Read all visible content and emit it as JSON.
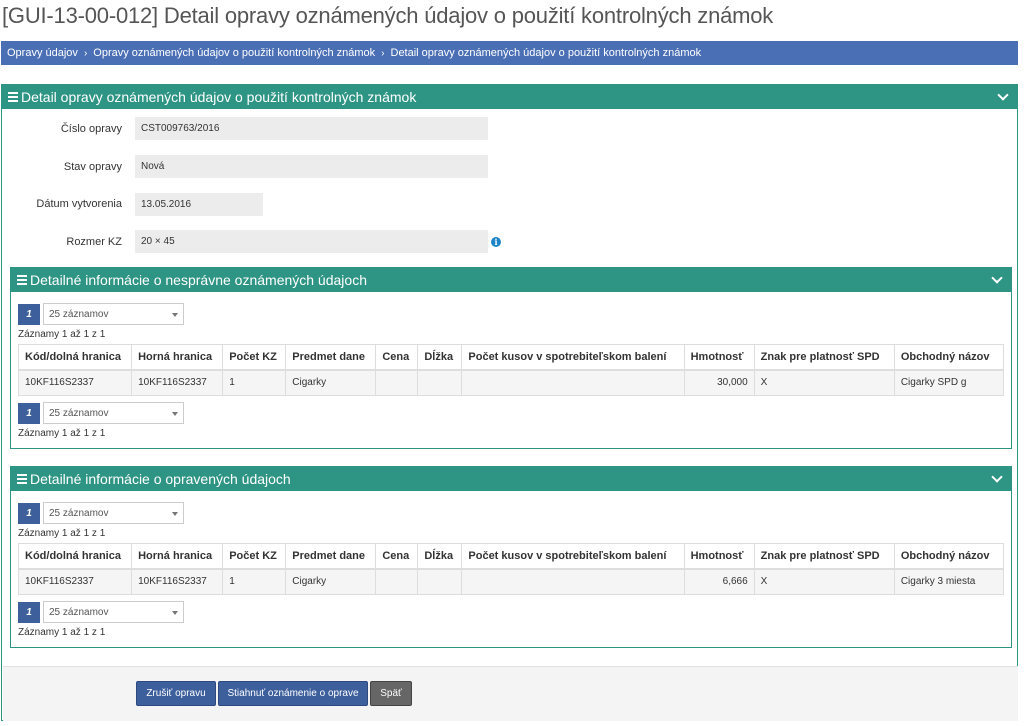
{
  "page_title": "[GUI-13-00-012] Detail opravy oznámených údajov o použití kontrolných známok",
  "breadcrumb": {
    "items": [
      "Opravy údajov",
      "Opravy oznámených údajov o použití kontrolných známok",
      "Detail opravy oznámených údajov o použití kontrolných známok"
    ],
    "separator": "›"
  },
  "main_panel": {
    "title": "Detail opravy oznámených údajov o použití kontrolných známok"
  },
  "form": {
    "cislo_opravy": {
      "label": "Číslo opravy",
      "value": "CST009763/2016"
    },
    "stav_opravy": {
      "label": "Stav opravy",
      "value": "Nová"
    },
    "datum_vytvorenia": {
      "label": "Dátum vytvorenia",
      "value": "13.05.2016"
    },
    "rozmer_kz": {
      "label": "Rozmer KZ",
      "value": "20 × 45"
    },
    "info_icon": "info-icon"
  },
  "pager": {
    "page": "1",
    "page_size": "25 záznamov",
    "records_info": "Záznamy 1 až 1 z 1"
  },
  "columns": [
    "Kód/dolná hranica",
    "Horná hranica",
    "Počet KZ",
    "Predmet dane",
    "Cena",
    "Dĺžka",
    "Počet kusov v spotrebiteľskom balení",
    "Hmotnosť",
    "Znak pre platnosť SPD",
    "Obchodný názov"
  ],
  "incorrect_panel": {
    "title": "Detailné informácie o nesprávne oznámených údajoch",
    "rows": [
      [
        "10KF116S2337",
        "10KF116S2337",
        "1",
        "Cigarky",
        "",
        "",
        "",
        "30,000",
        "X",
        "Cigarky SPD g"
      ]
    ]
  },
  "corrected_panel": {
    "title": "Detailné informácie o opravených údajoch",
    "rows": [
      [
        "10KF116S2337",
        "10KF116S2337",
        "1",
        "Cigarky",
        "",
        "",
        "",
        "6,666",
        "X",
        "Cigarky 3 miesta"
      ]
    ]
  },
  "buttons": {
    "cancel": "Zrušiť opravu",
    "download": "Stiahnuť oznámenie o oprave",
    "back": "Späť"
  },
  "colors": {
    "accent_teal": "#2e9484",
    "breadcrumb_blue": "#4a6fb5",
    "primary_button": "#3d5f9c",
    "info_blue": "#1d84c8"
  }
}
